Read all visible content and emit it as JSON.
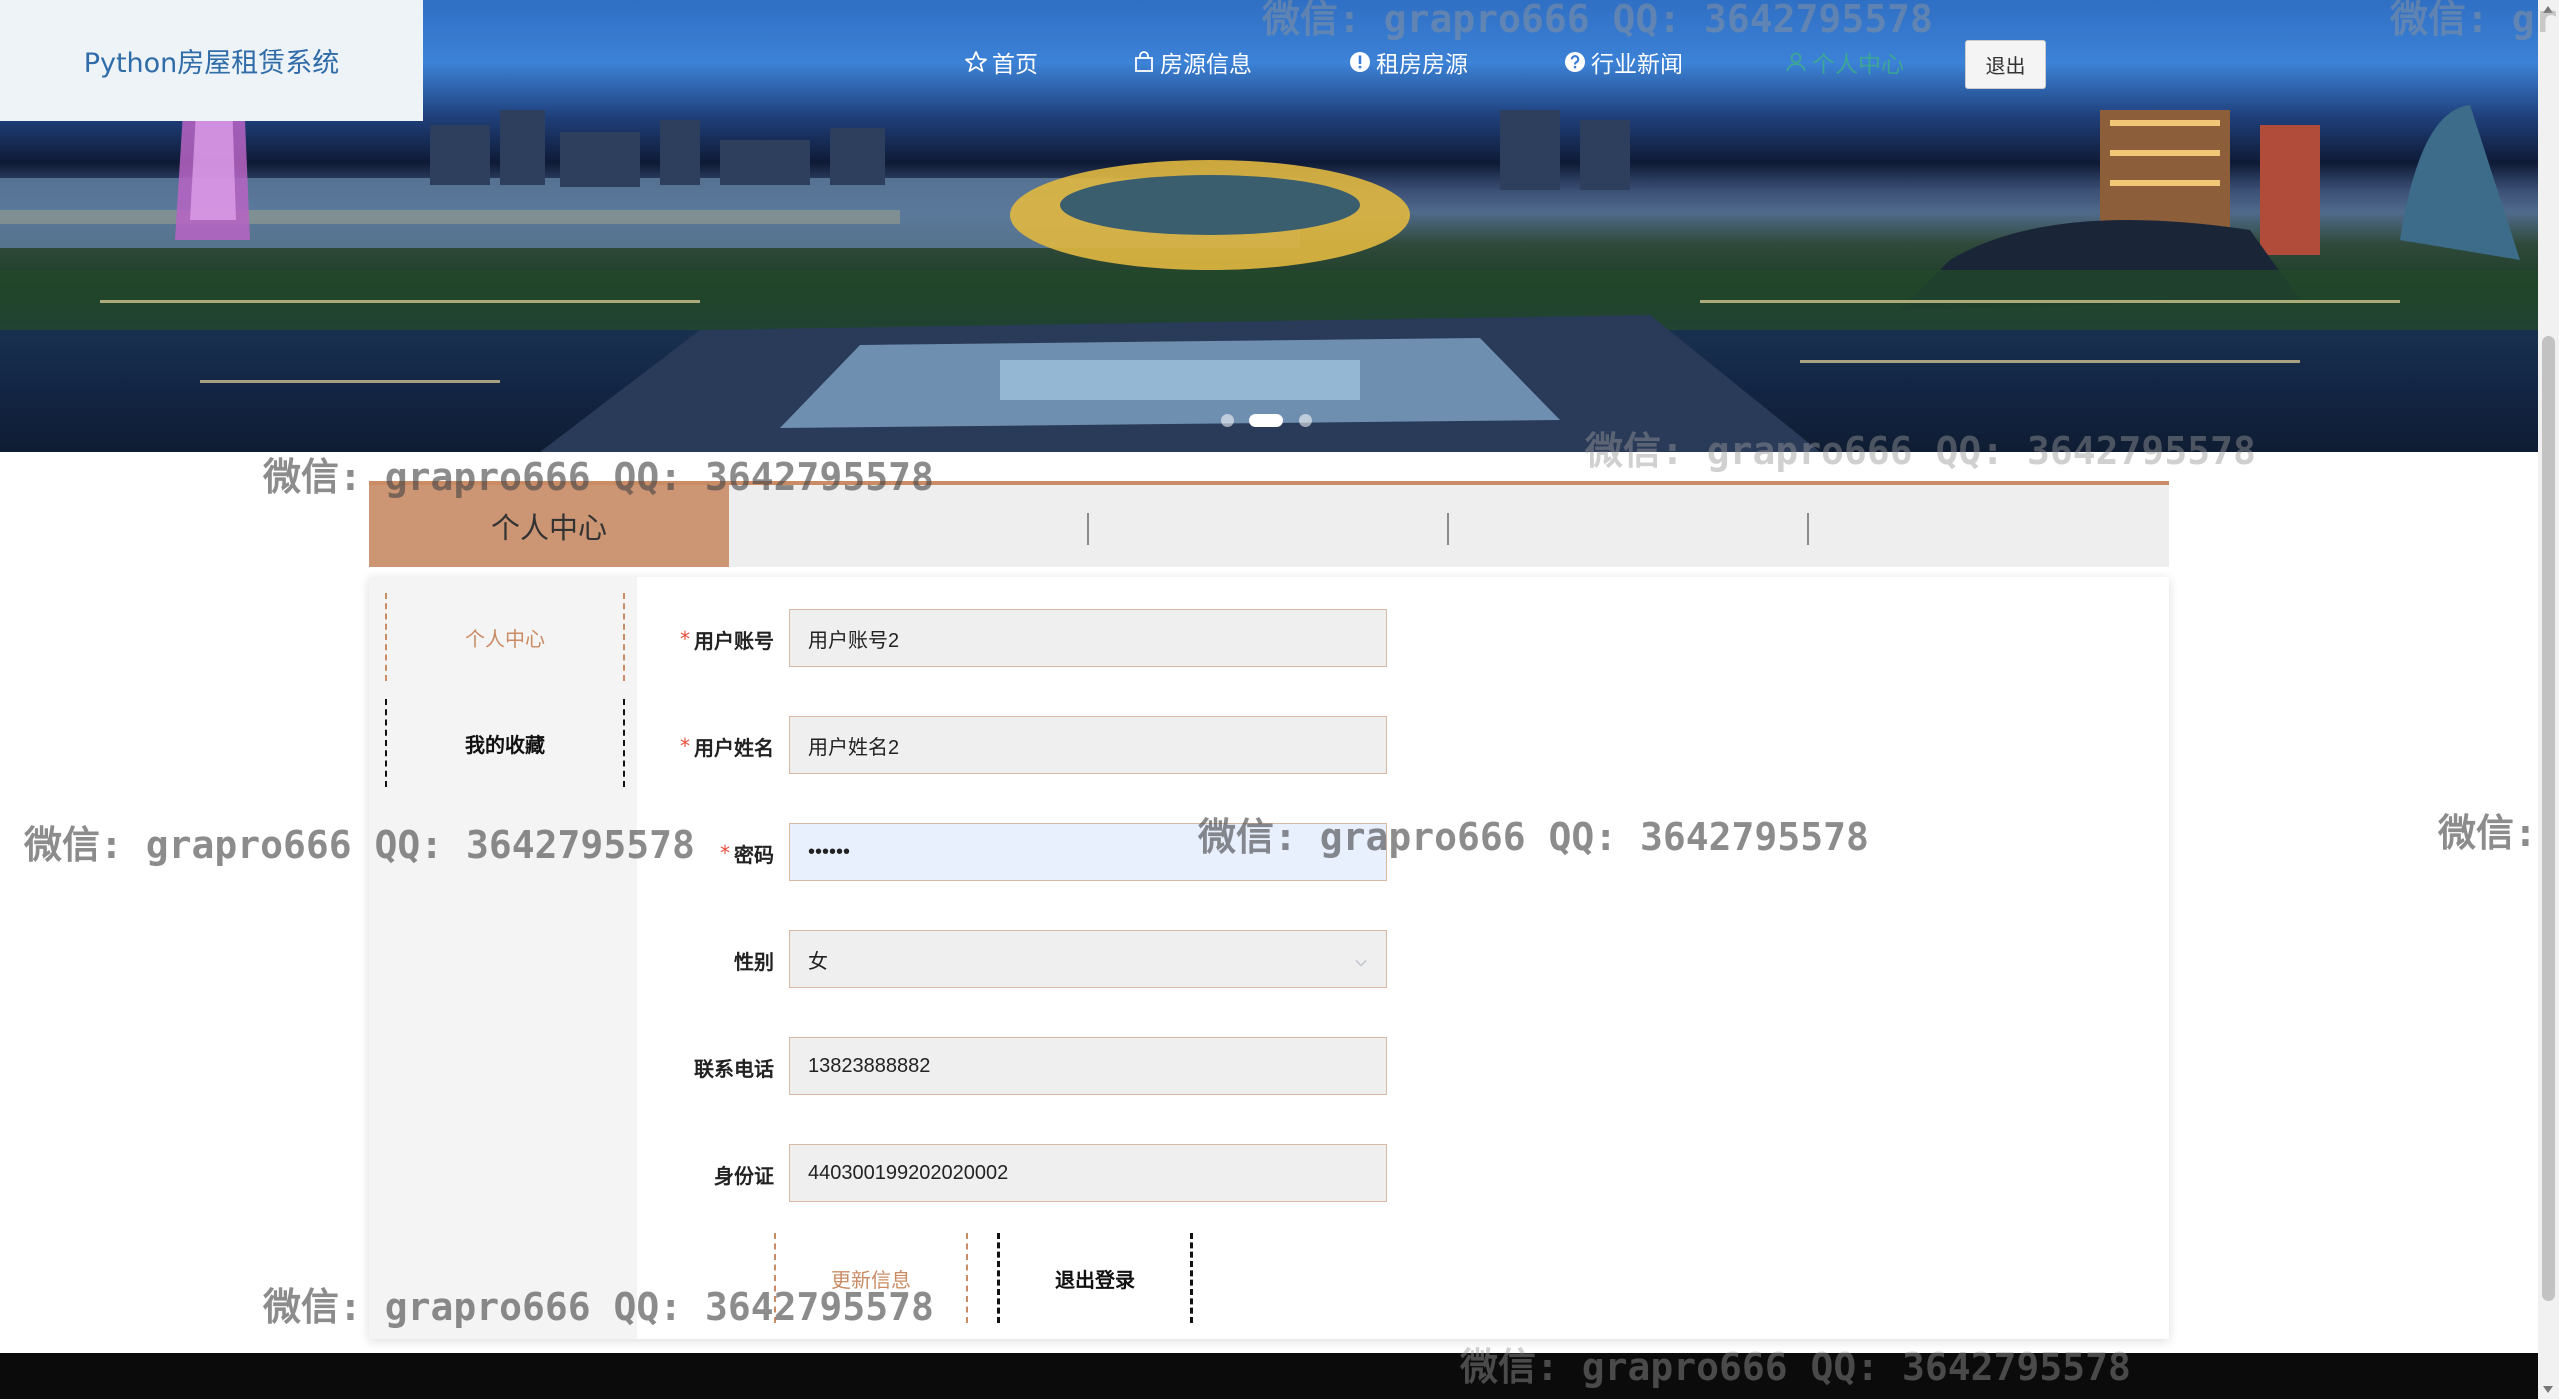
{
  "header": {
    "logo": "Python房屋租赁系统",
    "nav": [
      {
        "label": "首页",
        "icon": "star-icon"
      },
      {
        "label": "房源信息",
        "icon": "bag-icon"
      },
      {
        "label": "租房房源",
        "icon": "exclamation-icon"
      },
      {
        "label": "行业新闻",
        "icon": "question-icon"
      },
      {
        "label": "个人中心",
        "icon": "person-icon"
      }
    ],
    "logout_label": "退出"
  },
  "banner": {
    "slides": 3,
    "active_slide": 2
  },
  "tabs": {
    "active_label": "个人中心"
  },
  "sidebar": {
    "items": [
      {
        "label": "个人中心",
        "active": true
      },
      {
        "label": "我的收藏",
        "active": false
      }
    ]
  },
  "form": {
    "account": {
      "label": "用户账号",
      "value": "用户账号2",
      "required": true
    },
    "name": {
      "label": "用户姓名",
      "value": "用户姓名2",
      "required": true
    },
    "password": {
      "label": "密码",
      "value": "123456",
      "required": true
    },
    "gender": {
      "label": "性别",
      "value": "女"
    },
    "phone": {
      "label": "联系电话",
      "value": "13823888882"
    },
    "idcard": {
      "label": "身份证",
      "value": "440300199202020002"
    },
    "required_mark": "*"
  },
  "actions": {
    "update_label": "更新信息",
    "logout_label": "退出登录"
  },
  "watermark": {
    "text": "微信: grapro666 QQ: 3642795578",
    "partial_prefix": "微信: gr",
    "edge_text": "微信:"
  },
  "colors": {
    "primary": "#3a7fd5",
    "accent": "#cc9574",
    "required": "#e74c3c"
  }
}
